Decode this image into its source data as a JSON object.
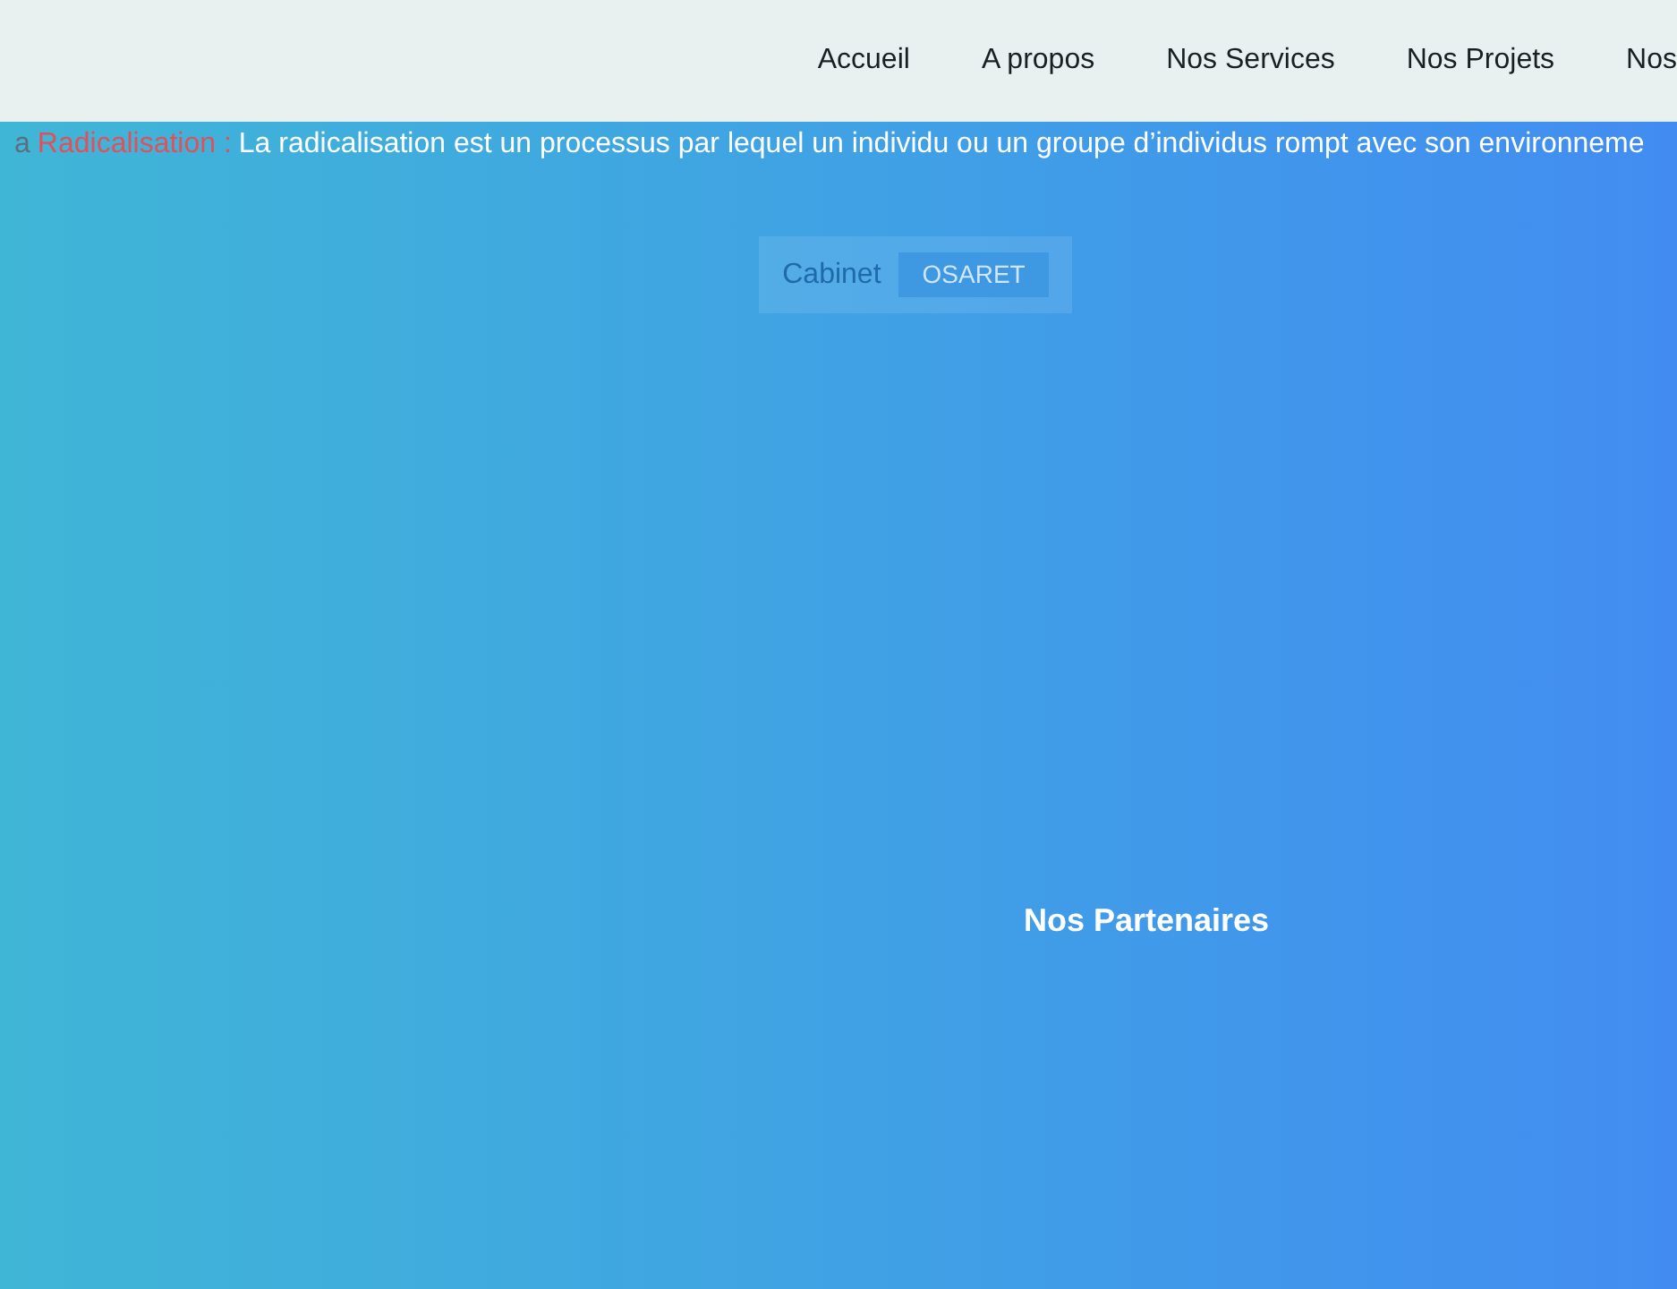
{
  "nav": {
    "items": [
      {
        "label": "Accueil"
      },
      {
        "label": "A propos"
      },
      {
        "label": "Nos Services"
      },
      {
        "label": "Nos Projets"
      },
      {
        "label": "Nos"
      }
    ]
  },
  "ticker": {
    "prefix": "a",
    "term": "Radicalisation :",
    "text": "La radicalisation est un processus par lequel un individu ou un groupe d’individus rompt avec son environneme"
  },
  "brand": {
    "label": "Cabinet",
    "badge": "OSARET"
  },
  "partners": {
    "title": "Nos Partenaires"
  }
}
